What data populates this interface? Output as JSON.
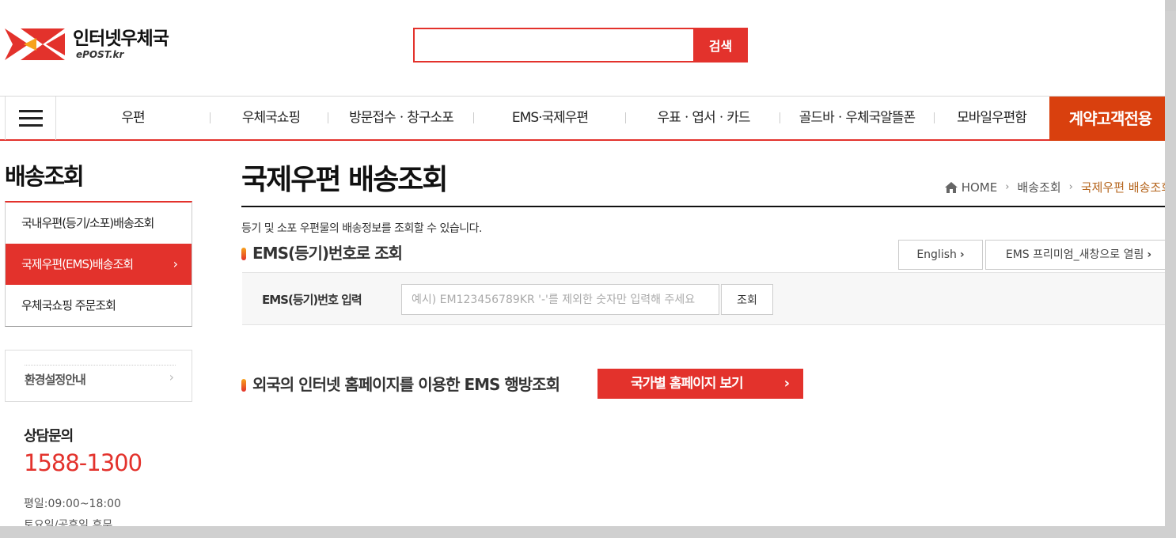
{
  "header": {
    "logo_title": "인터넷우체국",
    "logo_sub": "ePOST.kr",
    "search_value": "",
    "search_button": "검색"
  },
  "gnb": {
    "items": [
      "우편",
      "우체국쇼핑",
      "방문접수ㆍ창구소포",
      "EMS·국제우편",
      "우표ㆍ엽서ㆍ카드",
      "골드바ㆍ우체국알뜰폰",
      "모바일우편함"
    ],
    "special": "계약고객전용"
  },
  "lnb": {
    "title": "배송조회",
    "items": [
      {
        "label": "국내우편(등기/소포)배송조회"
      },
      {
        "label": "국제우편(EMS)배송조회",
        "arrow": "›"
      },
      {
        "label": "우체국쇼핑 주문조회"
      }
    ],
    "settings_label": "환경설정안내",
    "settings_arrow": "›",
    "cs_title": "상담문의",
    "cs_phone": "1588-1300",
    "cs_hours_weekday": "평일:09:00~18:00",
    "cs_hours_weekend": "토요일/공휴일 휴무"
  },
  "main": {
    "title": "국제우편 배송조회",
    "breadcrumb": [
      "HOME",
      "배송조회",
      "국제우편 배송조회"
    ],
    "breadcrumb_sep": "›",
    "description": "등기 및 소포 우편물의 배송정보를 조회할 수 있습니다.",
    "section1_title": "EMS(등기)번호로 조회",
    "english_button": "English",
    "ems_premium_button": "EMS 프리미엄_새창으로 열림",
    "chevron": "›",
    "lookup_label": "EMS(등기)번호 입력",
    "lookup_placeholder": "예시) EM123456789KR '-'를 제외한 숫자만 입력해 주세요",
    "lookup_button": "조회",
    "section2_title": "외국의 인터넷 홈페이지를 이용한 EMS 행방조회",
    "country_button": "국가별 홈페이지 보기",
    "country_chevron": "›"
  },
  "colors": {
    "accent": "#e3322c",
    "special": "#d9400e",
    "breadcrumb_current": "#b5651d"
  }
}
